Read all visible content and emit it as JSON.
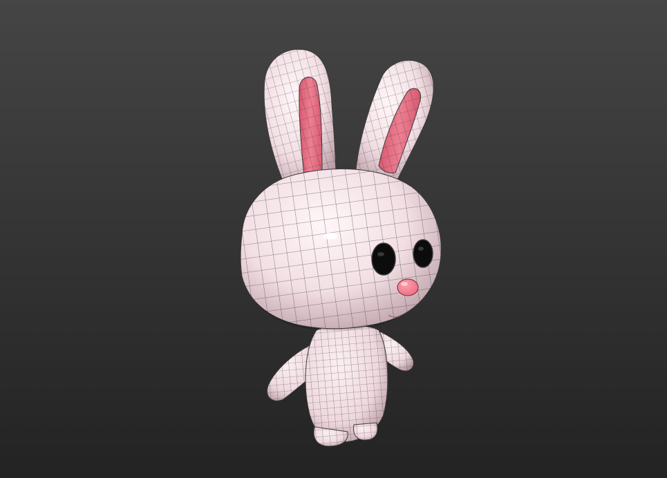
{
  "viewport": {
    "background_top": "#454545",
    "background_bottom": "#232323",
    "model_color": "#f2dfe4",
    "model_shade": "#b89aa3",
    "inner_ear_color": "#ee7f93",
    "nose_color": "#f06d80",
    "eye_color": "#0c0c0c",
    "wire_color": "#2f2f2f"
  }
}
